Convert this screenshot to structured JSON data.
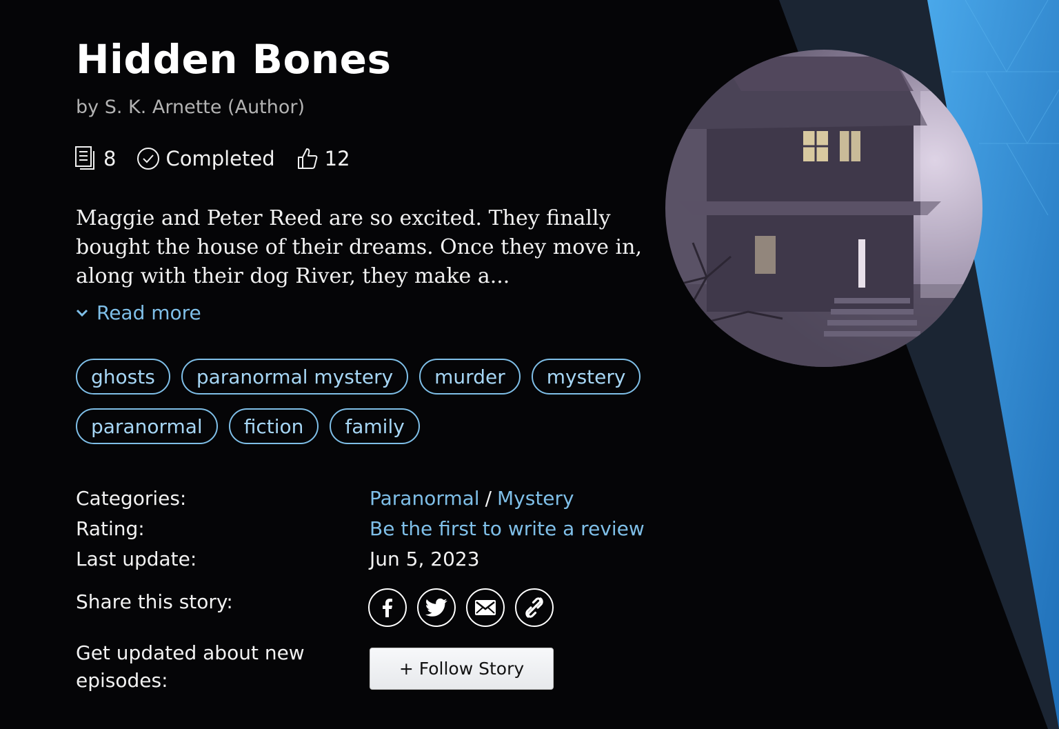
{
  "story": {
    "title": "Hidden Bones",
    "author_line": "by S. K. Arnette (Author)",
    "stats": {
      "episodes": "8",
      "status": "Completed",
      "likes": "12"
    },
    "description": "Maggie and Peter Reed are so excited. They finally bought the house of their dreams. Once they move in, along with their dog River, they make a...",
    "read_more_label": "Read more",
    "tags": [
      "ghosts",
      "paranormal mystery",
      "murder",
      "mystery",
      "paranormal",
      "fiction",
      "family"
    ]
  },
  "details": {
    "categories_label": "Categories:",
    "categories": [
      "Paranormal",
      "Mystery"
    ],
    "category_separator": "/",
    "rating_label": "Rating:",
    "rating_link": "Be the first to write a review",
    "last_update_label": "Last update:",
    "last_update_value": "Jun 5, 2023",
    "share_label": "Share this story:",
    "share_icons": [
      "facebook-icon",
      "twitter-icon",
      "email-icon",
      "link-icon"
    ],
    "follow_prompt": "Get updated about new episodes:",
    "follow_button": "+ Follow Story"
  },
  "colors": {
    "background": "#050507",
    "link": "#7fbfe8",
    "tag_border": "#7fbfe8",
    "accent_blue": "#3a8fd6"
  }
}
